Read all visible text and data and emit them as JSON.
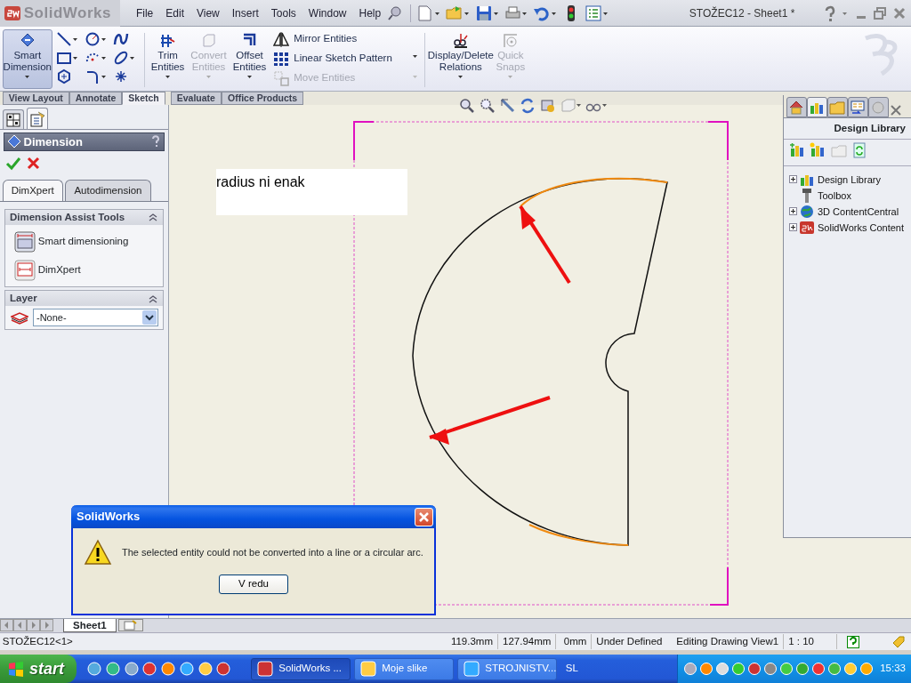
{
  "app": {
    "logo": "SolidWorks",
    "menus": [
      "File",
      "Edit",
      "View",
      "Insert",
      "Tools",
      "Window",
      "Help"
    ],
    "title": "STOŽEC12 - Sheet1 *"
  },
  "ribbon": {
    "main_tool": {
      "label": "Smart Dimension",
      "selected": true
    },
    "edit_tools": [
      {
        "label": "Trim Entities",
        "disabled": false
      },
      {
        "label": "Convert Entities",
        "disabled": true
      },
      {
        "label": "Offset Entities",
        "disabled": false
      }
    ],
    "list_tools": [
      {
        "label": "Mirror Entities",
        "disabled": false
      },
      {
        "label": "Linear Sketch Pattern",
        "disabled": false
      },
      {
        "label": "Move Entities",
        "disabled": true
      }
    ],
    "relation_tools": [
      {
        "label": "Display/Delete Relations",
        "disabled": false
      },
      {
        "label": "Quick Snaps",
        "disabled": true
      }
    ]
  },
  "command_tabs": [
    {
      "label": "View Layout",
      "selected": false
    },
    {
      "label": "Annotate",
      "selected": false
    },
    {
      "label": "Sketch",
      "selected": true
    },
    {
      "label": "Evaluate",
      "selected": false
    },
    {
      "label": "Office Products",
      "selected": false
    }
  ],
  "property_manager": {
    "title": "Dimension",
    "tabs": [
      {
        "label": "DimXpert",
        "selected": true
      },
      {
        "label": "Autodimension",
        "selected": false
      }
    ],
    "sections": [
      {
        "kind": "tools",
        "title": "Dimension Assist Tools",
        "items": [
          "Smart dimensioning",
          "DimXpert"
        ]
      },
      {
        "kind": "layer",
        "title": "Layer",
        "value": "-None-"
      }
    ]
  },
  "canvas": {
    "note": "radius ni enak"
  },
  "design_library": {
    "tabs": [
      {
        "selected": false
      },
      {
        "selected": true
      },
      {
        "selected": false
      },
      {
        "selected": false
      },
      {
        "selected": false
      }
    ],
    "title": "Design Library",
    "tree": [
      {
        "label": "Design Library",
        "expanded": false
      },
      {
        "label": "Toolbox"
      },
      {
        "label": "3D ContentCentral",
        "expanded": false
      },
      {
        "label": "SolidWorks Content",
        "expanded": false
      }
    ]
  },
  "dialog": {
    "title": "SolidWorks",
    "message": "The selected entity could not be converted into a line or a circular arc.",
    "button": "V redu"
  },
  "sheet_tabs": [
    {
      "label": "Sheet1",
      "selected": true
    }
  ],
  "status_bar": {
    "document": "STOŽEC12<1>",
    "fields": [
      "119.3mm",
      "127.94mm",
      "0mm",
      "Under Defined",
      "Editing Drawing View1",
      "1 : 10"
    ]
  },
  "taskbar": {
    "start": "start",
    "tasks": [
      {
        "label": "SolidWorks ...",
        "selected": true
      },
      {
        "label": "Moje slike",
        "selected": false
      },
      {
        "label": "STROJNISTV...",
        "selected": false
      }
    ],
    "language": "SL",
    "clock": "15:33"
  }
}
